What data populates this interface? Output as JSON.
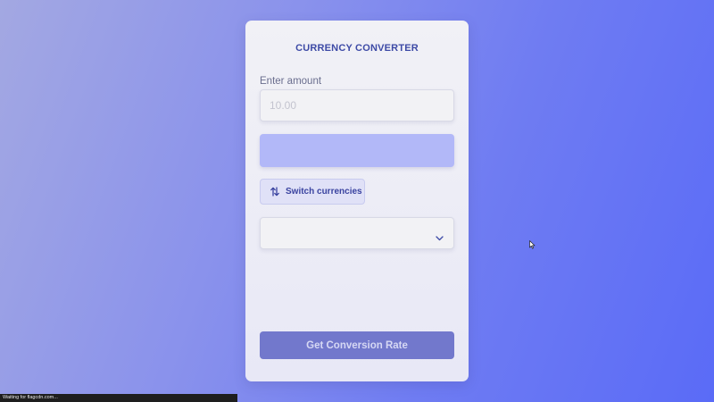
{
  "converter": {
    "title": "CURRENCY CONVERTER",
    "amount_label": "Enter amount",
    "amount_placeholder": "10.00",
    "amount_value": "",
    "from_currency": "",
    "switch_label": "Switch currencies",
    "to_currency": "",
    "convert_label": "Get Conversion Rate"
  },
  "status_bar": {
    "text": "Waiting for flagcdn.com..."
  },
  "icons": {
    "switch": "swap-vertical-icon",
    "dropdown": "chevron-down-icon",
    "cursor": "mouse-pointer-icon"
  },
  "colors": {
    "accent": "#3d4aa6",
    "from_select_fill": "#b2b8f8",
    "convert_button": "#7278cc"
  }
}
